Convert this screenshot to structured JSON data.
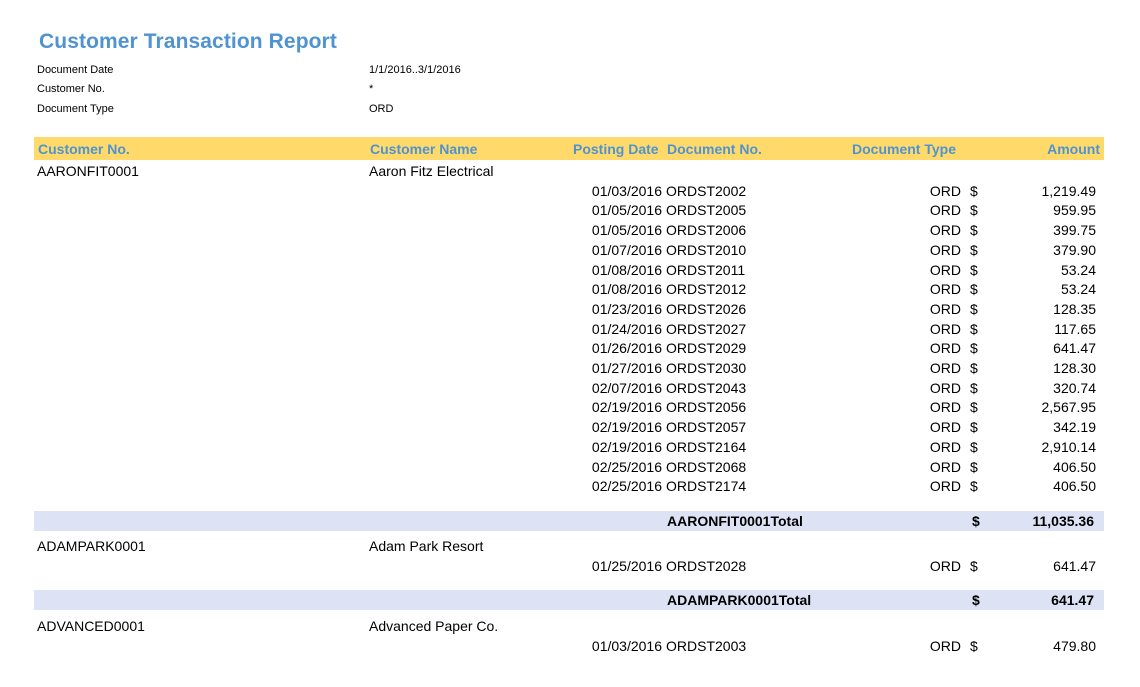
{
  "report": {
    "title": "Customer Transaction Report",
    "filters": [
      {
        "label": "Document Date",
        "value": "1/1/2016..3/1/2016"
      },
      {
        "label": "Customer No.",
        "value": "*"
      },
      {
        "label": "Document Type",
        "value": "ORD"
      }
    ],
    "columns": {
      "customer_no": "Customer No.",
      "customer_name": "Customer Name",
      "posting_date": "Posting Date",
      "document_no": "Document No.",
      "document_type": "Document Type",
      "amount": "Amount"
    },
    "currency_symbol": "$",
    "groups": [
      {
        "customer_no": "AARONFIT0001",
        "customer_name": "Aaron Fitz Electrical",
        "lines": [
          {
            "date": "01/03/2016",
            "doc": "ORDST2002",
            "type": "ORD",
            "amount": "1,219.49"
          },
          {
            "date": "01/05/2016",
            "doc": "ORDST2005",
            "type": "ORD",
            "amount": "959.95"
          },
          {
            "date": "01/05/2016",
            "doc": "ORDST2006",
            "type": "ORD",
            "amount": "399.75"
          },
          {
            "date": "01/07/2016",
            "doc": "ORDST2010",
            "type": "ORD",
            "amount": "379.90"
          },
          {
            "date": "01/08/2016",
            "doc": "ORDST2011",
            "type": "ORD",
            "amount": "53.24"
          },
          {
            "date": "01/08/2016",
            "doc": "ORDST2012",
            "type": "ORD",
            "amount": "53.24"
          },
          {
            "date": "01/23/2016",
            "doc": "ORDST2026",
            "type": "ORD",
            "amount": "128.35"
          },
          {
            "date": "01/24/2016",
            "doc": "ORDST2027",
            "type": "ORD",
            "amount": "117.65"
          },
          {
            "date": "01/26/2016",
            "doc": "ORDST2029",
            "type": "ORD",
            "amount": "641.47"
          },
          {
            "date": "01/27/2016",
            "doc": "ORDST2030",
            "type": "ORD",
            "amount": "128.30"
          },
          {
            "date": "02/07/2016",
            "doc": "ORDST2043",
            "type": "ORD",
            "amount": "320.74"
          },
          {
            "date": "02/19/2016",
            "doc": "ORDST2056",
            "type": "ORD",
            "amount": "2,567.95"
          },
          {
            "date": "02/19/2016",
            "doc": "ORDST2057",
            "type": "ORD",
            "amount": "342.19"
          },
          {
            "date": "02/19/2016",
            "doc": "ORDST2164",
            "type": "ORD",
            "amount": "2,910.14"
          },
          {
            "date": "02/25/2016",
            "doc": "ORDST2068",
            "type": "ORD",
            "amount": "406.50"
          },
          {
            "date": "02/25/2016",
            "doc": "ORDST2174",
            "type": "ORD",
            "amount": "406.50"
          }
        ],
        "total_label": "AARONFIT0001Total",
        "total": "11,035.36"
      },
      {
        "customer_no": "ADAMPARK0001",
        "customer_name": "Adam Park Resort",
        "lines": [
          {
            "date": "01/25/2016",
            "doc": "ORDST2028",
            "type": "ORD",
            "amount": "641.47"
          }
        ],
        "total_label": "ADAMPARK0001Total",
        "total": "641.47"
      },
      {
        "customer_no": "ADVANCED0001",
        "customer_name": "Advanced Paper Co.",
        "lines": [
          {
            "date": "01/03/2016",
            "doc": "ORDST2003",
            "type": "ORD",
            "amount": "479.80"
          }
        ]
      }
    ]
  },
  "colors": {
    "title": "#4f93d1",
    "header_bg": "#ffda6b",
    "total_bg": "#dde3f5"
  }
}
